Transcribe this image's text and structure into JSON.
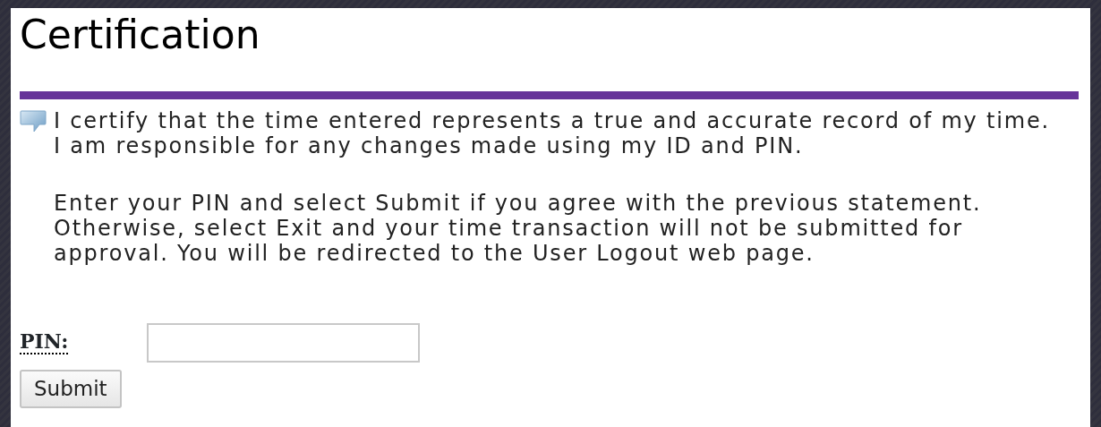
{
  "title": "Certification",
  "certification": {
    "lines": [
      "I certify that the time entered represents a true and accurate record of my time.",
      "I am responsible for any changes made using my ID and PIN."
    ]
  },
  "instructions": {
    "lines": [
      "Enter your PIN and select Submit if you agree with the previous statement.",
      "Otherwise, select Exit and your time transaction will not be submitted for",
      "approval. You will be redirected to the User Logout web page."
    ]
  },
  "pin_field": {
    "label": "PIN:"
  },
  "buttons": [
    {
      "label": "Submit"
    }
  ]
}
